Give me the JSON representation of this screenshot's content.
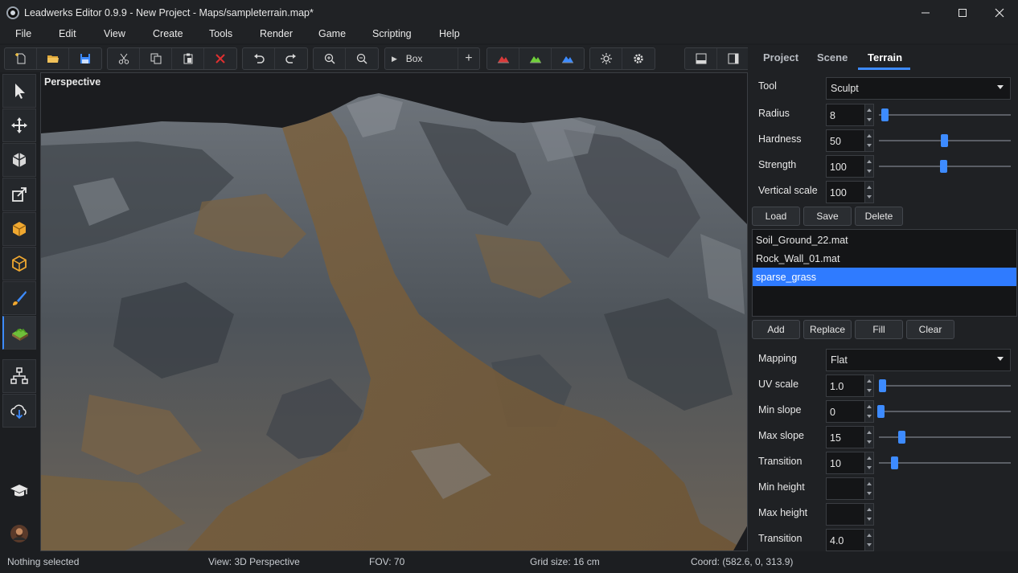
{
  "window": {
    "title": "Leadwerks Editor 0.9.9 - New Project - Maps/sampleterrain.map*",
    "controls": [
      "minimize-icon",
      "maximize-icon",
      "close-icon"
    ]
  },
  "menu": [
    "File",
    "Edit",
    "View",
    "Create",
    "Tools",
    "Render",
    "Game",
    "Scripting",
    "Help"
  ],
  "toolbar": {
    "create_selector_label": "Box",
    "icons": [
      "new-file-icon",
      "open-folder-icon",
      "save-icon",
      "cut-icon",
      "copy-icon",
      "paste-icon",
      "delete-icon",
      "undo-icon",
      "redo-icon",
      "zoom-in-icon",
      "zoom-out-icon",
      "play-arrow-icon",
      "add-icon",
      "terrain-red-icon",
      "terrain-green-icon",
      "terrain-blue-icon",
      "light-icon",
      "settings-gear-icon",
      "layout-bottom-icon",
      "layout-right-icon"
    ]
  },
  "left_tools": [
    "select-arrow-icon",
    "move-icon",
    "rotate-icon",
    "scale-icon",
    "solid-box-icon",
    "vertex-box-icon",
    "paint-brush-icon",
    "terrain-icon",
    "hierarchy-icon",
    "cloud-download-icon",
    "graduation-cap-icon",
    "user-avatar-icon"
  ],
  "viewport": {
    "label": "Perspective"
  },
  "panel": {
    "tabs": [
      "Project",
      "Scene",
      "Terrain"
    ],
    "active_tab": "Terrain",
    "tool_label": "Tool",
    "tool_value": "Sculpt",
    "sculpt": [
      {
        "label": "Radius",
        "value": "8",
        "slider": 0.03
      },
      {
        "label": "Hardness",
        "value": "50",
        "slider": 0.5
      },
      {
        "label": "Strength",
        "value": "100",
        "slider": 0.5
      },
      {
        "label": "Vertical scale",
        "value": "100"
      }
    ],
    "file_buttons": [
      "Load",
      "Save",
      "Delete"
    ],
    "materials": [
      "Soil_Ground_22.mat",
      "Rock_Wall_01.mat",
      "sparse_grass"
    ],
    "selected_material": "sparse_grass",
    "material_buttons": [
      "Add",
      "Replace",
      "Fill",
      "Clear"
    ],
    "mapping_label": "Mapping",
    "mapping_value": "Flat",
    "layer_props": [
      {
        "label": "UV scale",
        "value": "1.0",
        "slider": 0.02
      },
      {
        "label": "Min slope",
        "value": "0",
        "slider": 0.0
      },
      {
        "label": "Max slope",
        "value": "15",
        "slider": 0.18
      },
      {
        "label": "Transition",
        "value": "10",
        "slider": 0.12
      },
      {
        "label": "Min height",
        "value": ""
      },
      {
        "label": "Max height",
        "value": ""
      },
      {
        "label": "Transition",
        "value": "4.0"
      }
    ]
  },
  "status": {
    "selection": "Nothing selected",
    "view": "View: 3D Perspective",
    "fov": "FOV: 70",
    "grid": "Grid size: 16 cm",
    "coord": "Coord: (582.6, 0, 313.9)"
  },
  "colors": {
    "accent": "#3d8bff",
    "background": "#1c1e21",
    "panel": "#1f2124"
  }
}
